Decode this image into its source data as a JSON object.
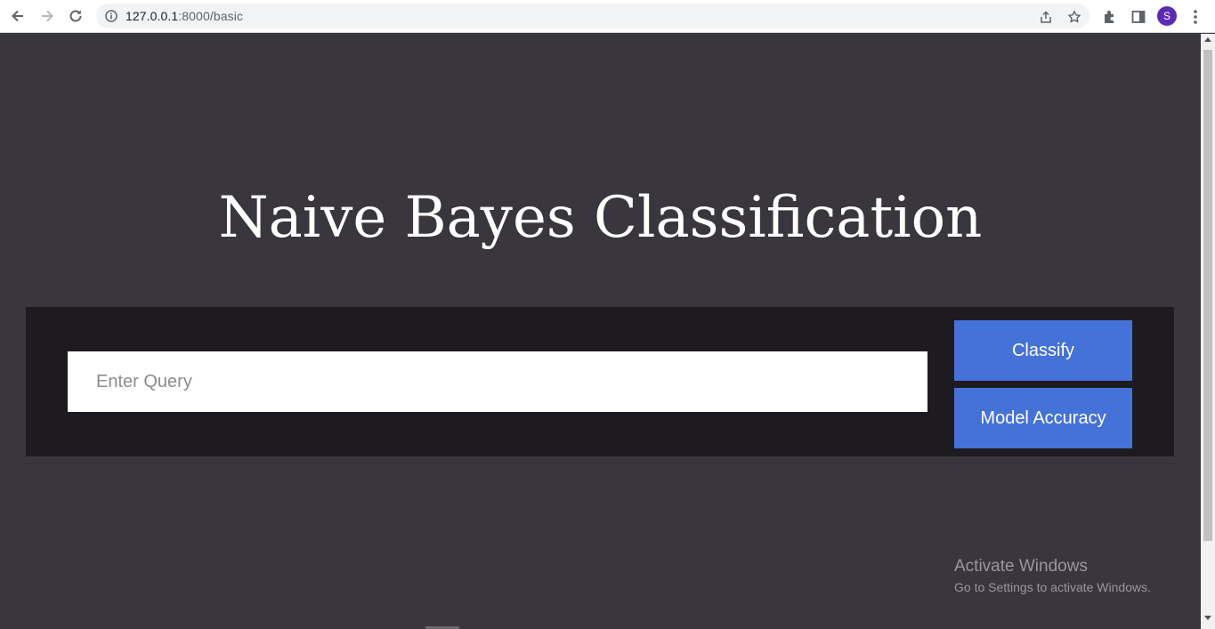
{
  "browser": {
    "url_host": "127.0.0.1",
    "url_path": ":8000/basic",
    "avatar_letter": "S",
    "icons": [
      "back-icon",
      "forward-icon",
      "reload-icon",
      "site-info-icon",
      "share-icon",
      "bookmark-star-icon",
      "extensions-icon",
      "side-panel-icon",
      "more-menu-icon"
    ]
  },
  "page": {
    "title": "Naive Bayes Classification",
    "query_placeholder": "Enter Query",
    "classify_label": "Classify",
    "accuracy_label": "Model Accuracy"
  },
  "watermark": {
    "line1": "Activate Windows",
    "line2": "Go to Settings to activate Windows."
  },
  "colors": {
    "page_bg": "#3a363d",
    "panel_bg": "#1d1b1f",
    "button_bg": "#4472d6",
    "avatar_bg": "#5b2bb5"
  }
}
